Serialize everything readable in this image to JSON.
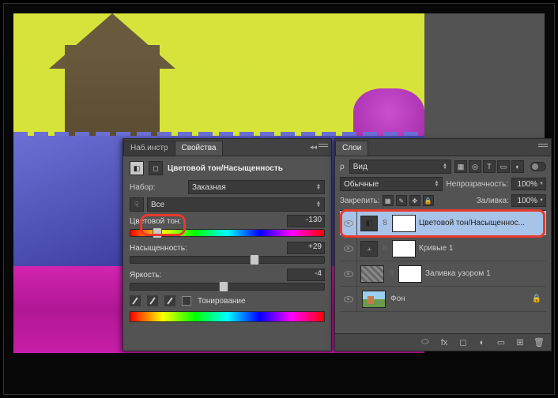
{
  "properties": {
    "tabs": {
      "tab1": "Наб.инстр",
      "tab2": "Свойства"
    },
    "title": "Цветовой тон/Насыщенность",
    "preset_label": "Набор:",
    "preset_value": "Заказная",
    "channel_value": "Все",
    "sliders": {
      "hue_label": "Цветовой тон:",
      "hue_value": "-130",
      "sat_label": "Насыщенность:",
      "sat_value": "+29",
      "light_label": "Яркость:",
      "light_value": "-4"
    },
    "colorize_label": "Тонирование"
  },
  "layers": {
    "tab": "Слои",
    "kind_label": "Вид",
    "blend_mode": "Обычные",
    "opacity_label": "Непрозрачность:",
    "opacity_value": "100%",
    "lock_label": "Закрепить:",
    "fill_label": "Заливка:",
    "fill_value": "100%",
    "items": [
      {
        "name": "Цветовой тон/Насыщеннос...",
        "type": "adj-hsl",
        "selected": true
      },
      {
        "name": "Кривые 1",
        "type": "adj-curves",
        "selected": false
      },
      {
        "name": "Заливка узором 1",
        "type": "fill-pattern",
        "selected": false
      },
      {
        "name": "Фон",
        "type": "image",
        "locked": true,
        "selected": false
      }
    ],
    "filter_icons": [
      "▦",
      "◎",
      "T",
      "▭",
      "◐"
    ]
  }
}
